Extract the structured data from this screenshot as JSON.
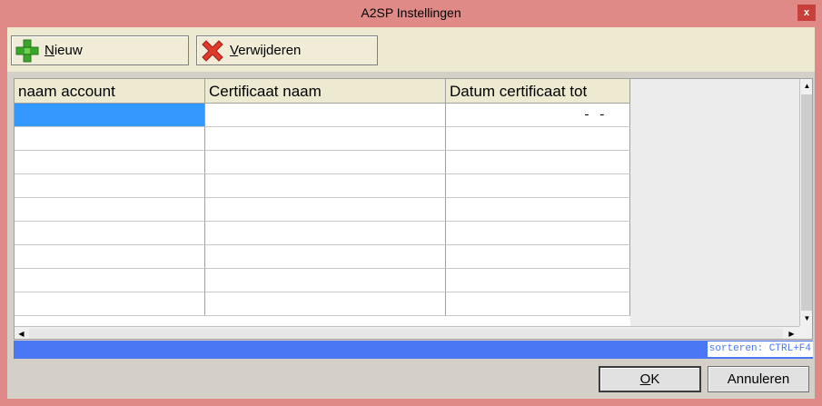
{
  "window": {
    "title": "A2SP Instellingen",
    "close_glyph": "x"
  },
  "toolbar": {
    "new_label_first": "N",
    "new_label_rest": "ieuw",
    "new_icon": "green-plus-icon",
    "delete_label_first": "V",
    "delete_label_rest": "erwijderen",
    "delete_icon": "red-x-icon"
  },
  "grid": {
    "columns": [
      "naam account",
      "Certificaat naam",
      "Datum certificaat tot"
    ],
    "rows": [
      {
        "account": "",
        "certificate": "",
        "date": "-  -"
      },
      {
        "account": "",
        "certificate": "",
        "date": ""
      },
      {
        "account": "",
        "certificate": "",
        "date": ""
      },
      {
        "account": "",
        "certificate": "",
        "date": ""
      },
      {
        "account": "",
        "certificate": "",
        "date": ""
      },
      {
        "account": "",
        "certificate": "",
        "date": ""
      },
      {
        "account": "",
        "certificate": "",
        "date": ""
      },
      {
        "account": "",
        "certificate": "",
        "date": ""
      },
      {
        "account": "",
        "certificate": "",
        "date": ""
      }
    ]
  },
  "status": {
    "sort_hint": "sorteren: CTRL+F4"
  },
  "dialog": {
    "ok_first": "O",
    "ok_rest": "K",
    "cancel_label": "Annuleren"
  },
  "colors": {
    "title_bar": "#e08a87",
    "selection": "#3399ff",
    "status_bar": "#4a78f5"
  }
}
